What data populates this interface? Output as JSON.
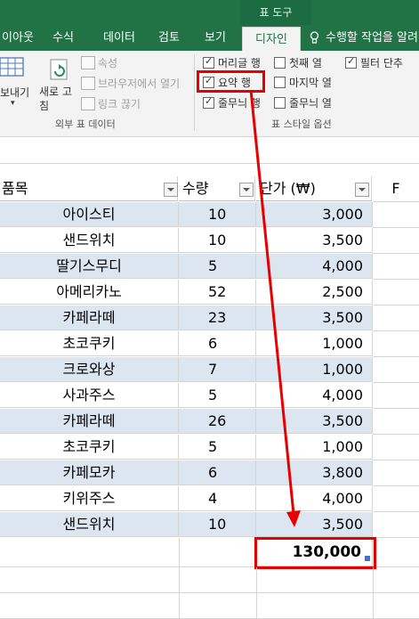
{
  "ribbon": {
    "context_label": "표 도구",
    "tabs": [
      "이아웃",
      "수식",
      "데이터",
      "검토",
      "보기",
      "디자인"
    ],
    "tell_me": "수행할 작업을 알려",
    "external_data": {
      "export_label": "보내기",
      "refresh_label": "새로 고침",
      "properties_label": "속성",
      "open_in_browser_label": "브라우저에서 열기",
      "unlink_label": "링크 끊기",
      "group_label": "외부 표 데이터"
    },
    "style_options": {
      "header_row": "머리글 행",
      "first_column": "첫째 열",
      "filter_button": "필터 단추",
      "total_row": "요약 행",
      "last_column": "마지막 열",
      "banded_rows": "줄무늬 행",
      "banded_columns": "줄무늬 열",
      "group_label": "표 스타일 옵션"
    }
  },
  "table": {
    "headers": [
      "품목",
      "수량",
      "단가 (₩)"
    ],
    "col_f_header": "F",
    "rows": [
      {
        "item": "아이스티",
        "qty": "10",
        "price": "3,000"
      },
      {
        "item": "샌드위치",
        "qty": "10",
        "price": "3,500"
      },
      {
        "item": "딸기스무디",
        "qty": "5",
        "price": "4,000"
      },
      {
        "item": "아메리카노",
        "qty": "52",
        "price": "2,500"
      },
      {
        "item": "카페라떼",
        "qty": "23",
        "price": "3,500"
      },
      {
        "item": "초코쿠키",
        "qty": "6",
        "price": "1,000"
      },
      {
        "item": "크로와상",
        "qty": "7",
        "price": "1,000"
      },
      {
        "item": "사과주스",
        "qty": "5",
        "price": "4,000"
      },
      {
        "item": "카페라떼",
        "qty": "26",
        "price": "3,500"
      },
      {
        "item": "초코쿠키",
        "qty": "5",
        "price": "1,000"
      },
      {
        "item": "카페모카",
        "qty": "6",
        "price": "3,800"
      },
      {
        "item": "키위주스",
        "qty": "4",
        "price": "4,000"
      },
      {
        "item": "샌드위치",
        "qty": "10",
        "price": "3,500"
      }
    ],
    "total": "130,000"
  }
}
